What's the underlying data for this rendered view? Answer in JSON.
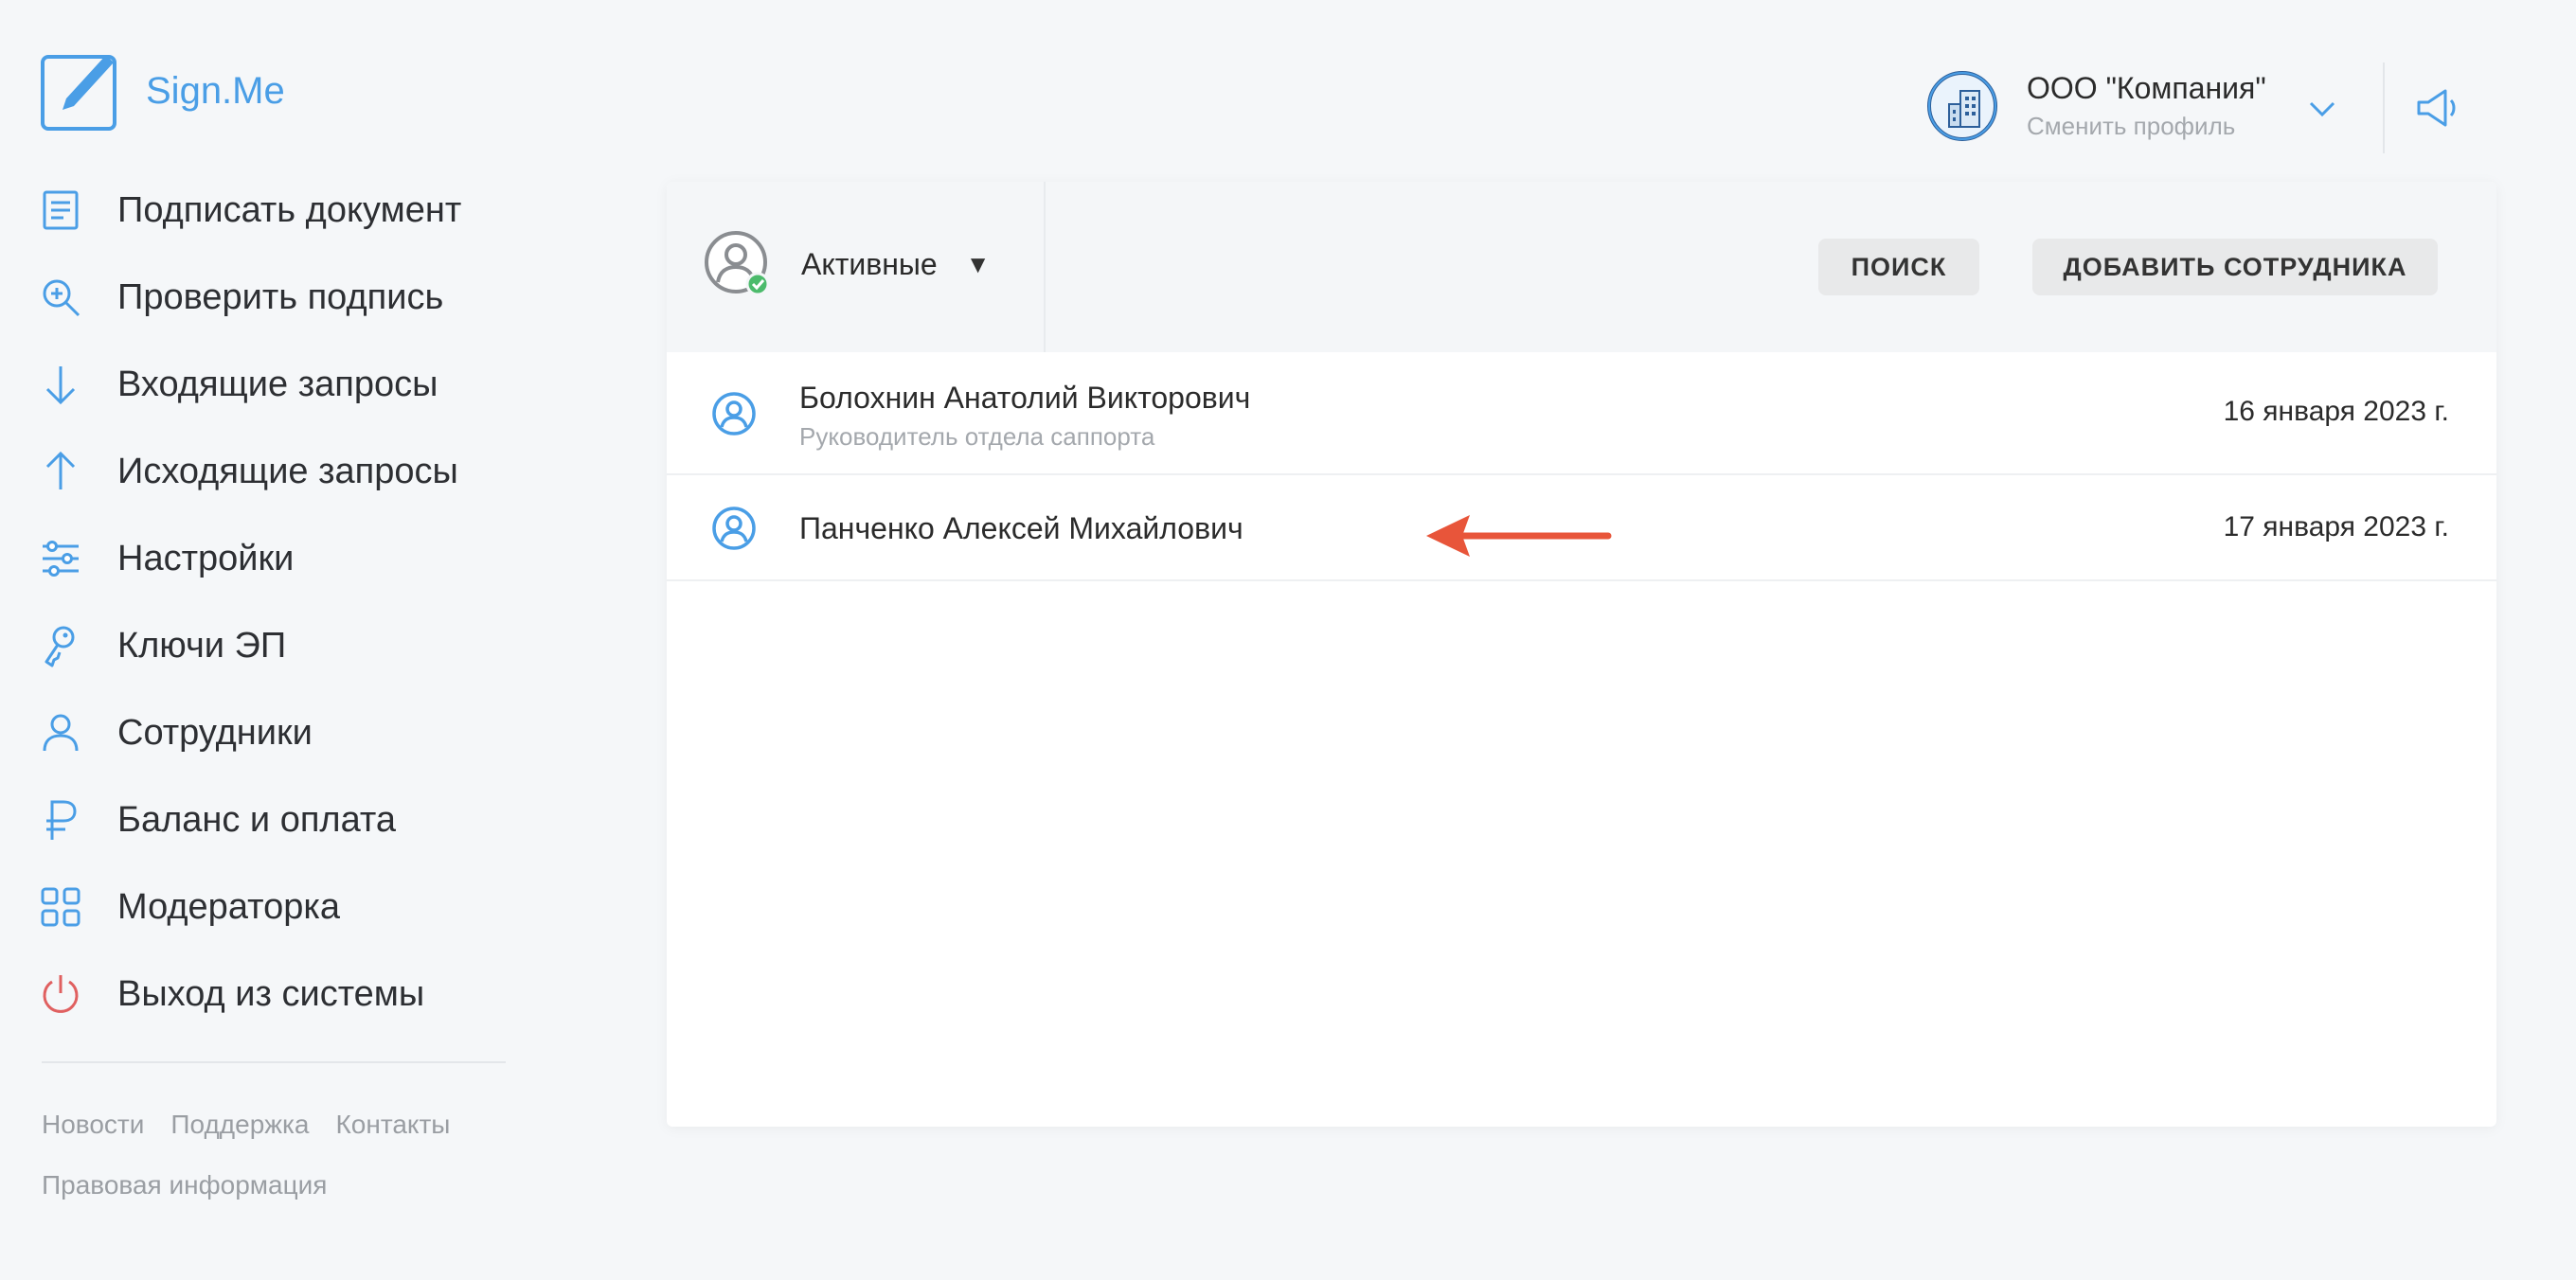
{
  "app": {
    "name": "Sign.Me"
  },
  "colors": {
    "accent": "#4a9ee6",
    "logout": "#e06060",
    "online": "#4cbb6c",
    "annotation": "#e8553a"
  },
  "sidebar": {
    "items": [
      {
        "label": "Подписать документ",
        "icon": "document-icon"
      },
      {
        "label": "Проверить подпись",
        "icon": "magnifier-plus-icon"
      },
      {
        "label": "Входящие запросы",
        "icon": "arrow-down-icon"
      },
      {
        "label": "Исходящие запросы",
        "icon": "arrow-up-icon"
      },
      {
        "label": "Настройки",
        "icon": "sliders-icon"
      },
      {
        "label": "Ключи ЭП",
        "icon": "key-icon"
      },
      {
        "label": "Сотрудники",
        "icon": "person-icon"
      },
      {
        "label": "Баланс и оплата",
        "icon": "ruble-icon"
      },
      {
        "label": "Модераторка",
        "icon": "grid-icon"
      },
      {
        "label": "Выход из системы",
        "icon": "power-icon"
      }
    ],
    "footer": [
      "Новости",
      "Поддержка",
      "Контакты",
      "Правовая информация"
    ]
  },
  "header": {
    "company": "ООО \"Компания\"",
    "switch_profile": "Сменить профиль"
  },
  "toolbar": {
    "filter_label": "Активные",
    "filter_caret": "▼",
    "search_button": "ПОИСК",
    "add_button": "ДОБАВИТЬ СОТРУДНИКА"
  },
  "employees": [
    {
      "name": "Болохнин Анатолий Викторович",
      "role": "Руководитель отдела саппорта",
      "date": "16 января 2023 г."
    },
    {
      "name": "Панченко Алексей Михайлович",
      "role": "",
      "date": "17 января 2023 г."
    }
  ]
}
